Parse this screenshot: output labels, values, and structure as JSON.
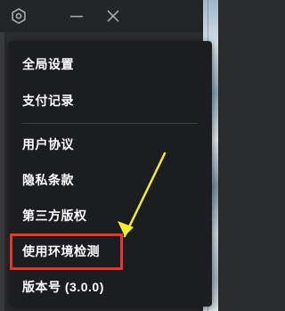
{
  "menu": {
    "group1": [
      {
        "label": "全局设置",
        "name": "menu-item-global-settings"
      },
      {
        "label": "支付记录",
        "name": "menu-item-payment-records"
      }
    ],
    "group2": [
      {
        "label": "用户协议",
        "name": "menu-item-user-agreement"
      },
      {
        "label": "隐私条款",
        "name": "menu-item-privacy-terms"
      },
      {
        "label": "第三方版权",
        "name": "menu-item-third-party-copyright"
      },
      {
        "label": "使用环境检测",
        "name": "menu-item-environment-check"
      },
      {
        "label": "版本号 (3.0.0)",
        "name": "menu-item-version"
      }
    ]
  },
  "titlebar": {
    "icons": [
      "gear-icon",
      "minimize-icon",
      "close-icon"
    ]
  },
  "annotation": {
    "highlight_color": "#e8352e",
    "arrow_color": "#f2ef2a",
    "highlighted_item": "使用环境检测"
  }
}
